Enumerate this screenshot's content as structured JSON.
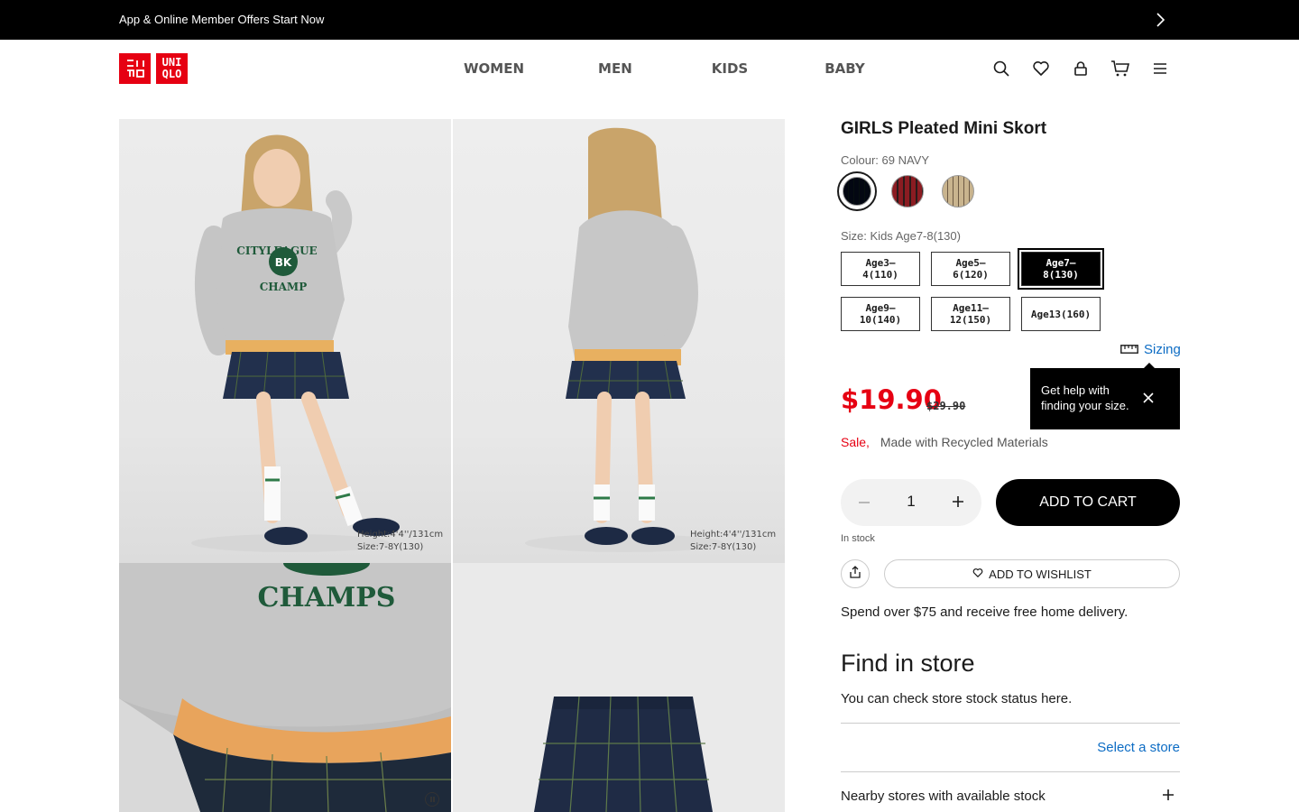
{
  "announcement": {
    "text": "App & Online Member Offers Start Now"
  },
  "logo": {
    "line1": "ユニ\nクロ",
    "line2": "UNI\nQLO"
  },
  "nav": {
    "women": "WOMEN",
    "men": "MEN",
    "kids": "KIDS",
    "baby": "BABY"
  },
  "header_icons": [
    "search-icon",
    "heart-icon",
    "user-icon",
    "cart-icon",
    "menu-icon"
  ],
  "gallery": {
    "captions": [
      {
        "height": "Height:4'4''/131cm",
        "size": "Size:7-8Y(130)"
      },
      {
        "height": "Height:4'4''/131cm",
        "size": "Size:7-8Y(130)"
      }
    ],
    "sweatshirt_text": {
      "arc": "CITYLEAGUE",
      "badge": "BK",
      "word": "CHAMP",
      "closeup": "CHAMPS"
    }
  },
  "product": {
    "title": "GIRLS Pleated Mini Skort",
    "colour_label": "Colour: 69 NAVY",
    "colours": [
      {
        "name": "69 NAVY",
        "hex": "#1d2a44",
        "selected": true
      },
      {
        "name": "RED",
        "hex": "#8b1c22",
        "selected": false
      },
      {
        "name": "BEIGE",
        "hex": "#c9b48e",
        "selected": false
      }
    ],
    "size_label": "Size: Kids Age7-8(130)",
    "sizes": [
      {
        "label": "Age3–4(110)",
        "selected": false
      },
      {
        "label": "Age5–6(120)",
        "selected": false
      },
      {
        "label": "Age7–8(130)",
        "selected": true
      },
      {
        "label": "Age9–10(140)",
        "selected": false
      },
      {
        "label": "Age11–12(150)",
        "selected": false
      },
      {
        "label": "Age13(160)",
        "selected": false
      }
    ],
    "sizing_link": "Sizing",
    "tooltip": "Get help with finding your size.",
    "price": "$19.90",
    "original_price": "$29.90",
    "sale_flag": "Sale,",
    "material_flag": "Made with Recycled Materials",
    "quantity": "1",
    "add_to_cart": "ADD TO CART",
    "stock_status": "In stock",
    "add_to_wishlist": "ADD TO WISHLIST",
    "delivery_note": "Spend over $75 and receive free home delivery."
  },
  "store": {
    "title": "Find in store",
    "subtitle": "You can check store stock status here.",
    "select_store": "Select a store",
    "nearby": "Nearby stores with available stock"
  },
  "colors": {
    "accent_red": "#e60012",
    "link_blue": "#0c6cc4",
    "black": "#000000"
  }
}
